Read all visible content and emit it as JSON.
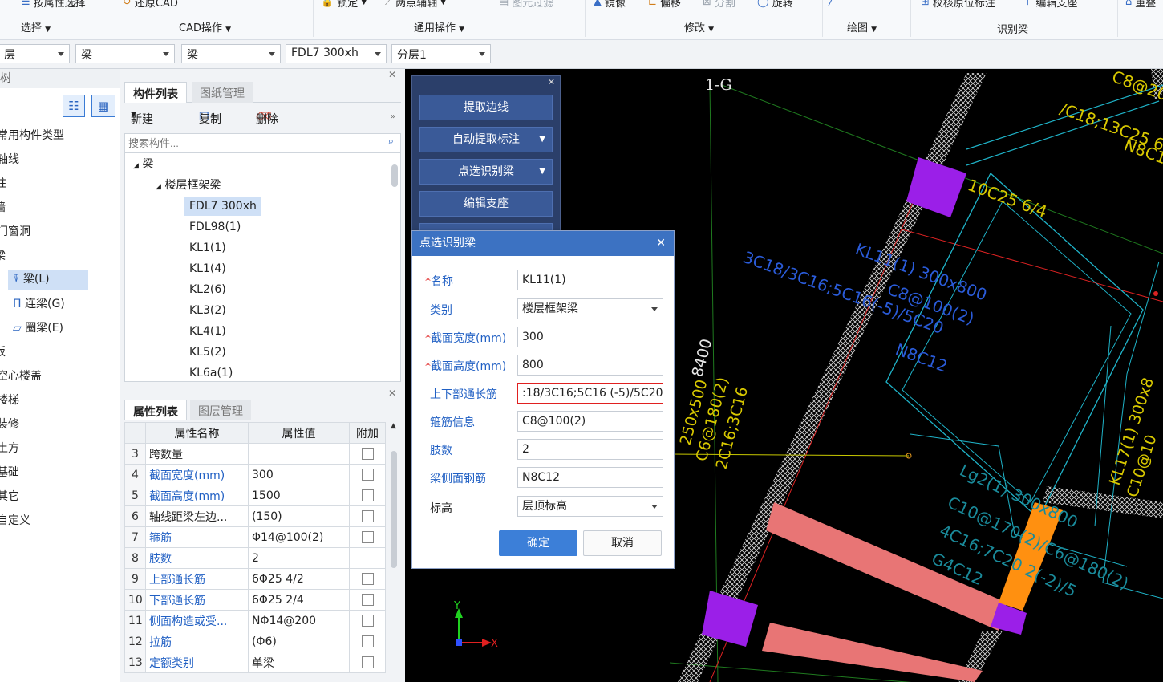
{
  "ribbon": {
    "top_items": [
      "按属性选择",
      "还原CAD",
      "锁定",
      "两点辅轴",
      "图元过滤",
      "镜像",
      "偏移",
      "分割",
      "旋转",
      "校核原位标注",
      "编辑支座",
      "重叠"
    ],
    "groups": [
      "选择",
      "CAD操作",
      "通用操作",
      "修改",
      "绘图",
      "识别梁"
    ]
  },
  "toolbar": {
    "floor": "层",
    "category": "梁",
    "type": "梁",
    "component": "FDL7 300xh",
    "layer": "分层1"
  },
  "left_tree": {
    "title": "树",
    "items": [
      "常用构件类型",
      "轴线",
      "柱",
      "墙",
      "门窗洞",
      "梁",
      "梁(L)",
      "连梁(G)",
      "圈梁(E)",
      "板",
      "空心楼盖",
      "楼梯",
      "装修",
      "土方",
      "基础",
      "其它",
      "自定义"
    ]
  },
  "component_panel": {
    "tabs": [
      "构件列表",
      "图纸管理"
    ],
    "buttons": {
      "new": "新建",
      "copy": "复制",
      "delete": "删除"
    },
    "search_placeholder": "搜索构件...",
    "tree_root": "梁",
    "tree_group": "楼层框架梁",
    "items": [
      "FDL7 300xh",
      "FDL98(1)",
      "KL1(1)",
      "KL1(4)",
      "KL2(6)",
      "KL3(2)",
      "KL4(1)",
      "KL5(2)",
      "KL6a(1)"
    ],
    "selected": "FDL7 300xh"
  },
  "property_panel": {
    "tabs": [
      "属性列表",
      "图层管理"
    ],
    "headers": {
      "name": "属性名称",
      "value": "属性值",
      "extra": "附加"
    },
    "rows": [
      {
        "no": "3",
        "name": "跨数量",
        "value": "",
        "blue": false
      },
      {
        "no": "4",
        "name": "截面宽度(mm)",
        "value": "300",
        "blue": true
      },
      {
        "no": "5",
        "name": "截面高度(mm)",
        "value": "1500",
        "blue": true
      },
      {
        "no": "6",
        "name": "轴线距梁左边...",
        "value": "(150)",
        "blue": false
      },
      {
        "no": "7",
        "name": "箍筋",
        "value": "Φ14@100(2)",
        "blue": true
      },
      {
        "no": "8",
        "name": "肢数",
        "value": "2",
        "blue": true
      },
      {
        "no": "9",
        "name": "上部通长筋",
        "value": "6Φ25 4/2",
        "blue": true
      },
      {
        "no": "10",
        "name": "下部通长筋",
        "value": "6Φ25 2/4",
        "blue": true
      },
      {
        "no": "11",
        "name": "侧面构造或受...",
        "value": "NΦ14@200",
        "blue": true
      },
      {
        "no": "12",
        "name": "拉筋",
        "value": "(Φ6)",
        "blue": true
      },
      {
        "no": "13",
        "name": "定额类别",
        "value": "单梁",
        "blue": true
      }
    ]
  },
  "float_panel": {
    "buttons": [
      "提取边线",
      "自动提取标注",
      "点选识别梁",
      "编辑支座"
    ]
  },
  "dialog": {
    "title": "点选识别梁",
    "fields": [
      {
        "label": "名称",
        "value": "KL11(1)",
        "required": true
      },
      {
        "label": "类别",
        "value": "楼层框架梁",
        "required": false
      },
      {
        "label": "截面宽度(mm)",
        "value": "300",
        "required": true
      },
      {
        "label": "截面高度(mm)",
        "value": "800",
        "required": true
      },
      {
        "label": "上下部通长筋",
        "value": ":18/3C16;5C16 (-5)/5C20",
        "required": false
      },
      {
        "label": "箍筋信息",
        "value": "C8@100(2)",
        "required": false
      },
      {
        "label": "肢数",
        "value": "2",
        "required": false
      },
      {
        "label": "梁侧面钢筋",
        "value": "N8C12",
        "required": false
      },
      {
        "label": "标高",
        "value": "层顶标高",
        "required": false
      }
    ],
    "ok": "确定",
    "cancel": "取消"
  },
  "cad": {
    "axis_label": "1-G",
    "texts": [
      "/C18;13C25 6",
      "C8@20",
      "N8C1",
      "10C25 6/4",
      "KL11(1) 300x800",
      "C8@100(2)",
      "3C18/3C16;5C16(-5)/5C20",
      "N8C12",
      "8400",
      "250x500",
      "C6@180(2)",
      "2C16;3C16",
      "KL17(1) 300x8",
      "C10@10",
      "Lg2(1) 300x800",
      "C10@170(2)/C6@180(2)",
      "4C16;7C20 2(-2)/5",
      "G4C12",
      "Y",
      "X"
    ]
  }
}
